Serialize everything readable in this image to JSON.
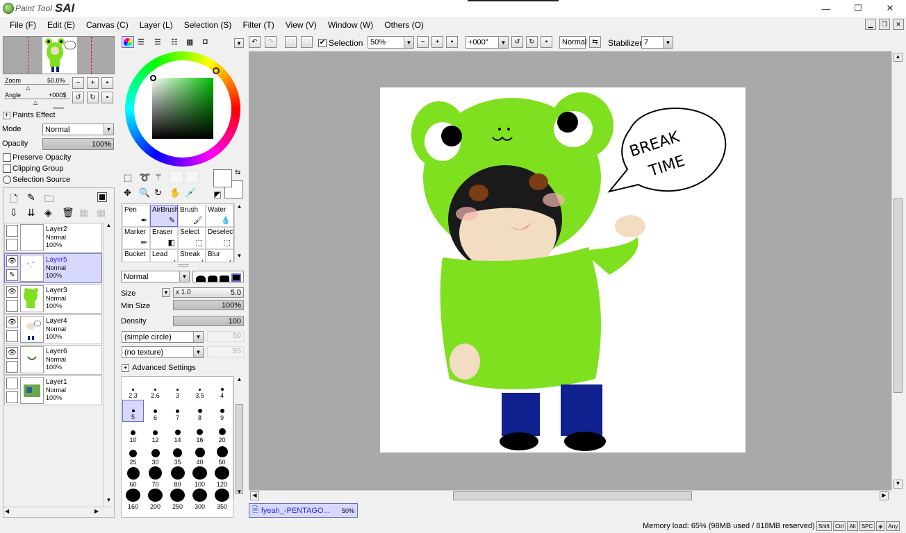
{
  "app": {
    "logo_text": "Paint Tool",
    "logo_sai": "SAI"
  },
  "window_buttons": {
    "minimize": "—",
    "maximize": "☐",
    "close": "✕"
  },
  "menu": [
    "File (F)",
    "Edit (E)",
    "Canvas (C)",
    "Layer (L)",
    "Selection (S)",
    "Filter (T)",
    "View (V)",
    "Window (W)",
    "Others (O)"
  ],
  "navigator": {
    "zoom_label": "Zoom",
    "zoom_value": "50.0%",
    "angle_label": "Angle",
    "angle_value": "+000$"
  },
  "paints_effect": {
    "header": "Paints Effect",
    "mode_label": "Mode",
    "mode_value": "Normal",
    "opacity_label": "Opacity",
    "opacity_value": "100%",
    "opacity_fraction": 1.0
  },
  "options": {
    "preserve_opacity": "Preserve Opacity",
    "clipping_group": "Clipping Group",
    "selection_source": "Selection Source"
  },
  "layers": [
    {
      "name": "Layer2",
      "mode": "Normal",
      "opacity": "100%",
      "visible": false,
      "selected": false
    },
    {
      "name": "Layer5",
      "mode": "Normal",
      "opacity": "100%",
      "visible": true,
      "selected": true
    },
    {
      "name": "Layer3",
      "mode": "Normal",
      "opacity": "100%",
      "visible": true,
      "selected": false
    },
    {
      "name": "Layer4",
      "mode": "Normal",
      "opacity": "100%",
      "visible": true,
      "selected": false
    },
    {
      "name": "Layer6",
      "mode": "Normal",
      "opacity": "100%",
      "visible": true,
      "selected": false
    },
    {
      "name": "Layer1",
      "mode": "Normal",
      "opacity": "100%",
      "visible": false,
      "selected": false
    }
  ],
  "tools": [
    {
      "label": "Pen",
      "icon": "✒",
      "selected": false
    },
    {
      "label": "AirBrush",
      "icon": "✎",
      "selected": true
    },
    {
      "label": "Brush",
      "icon": "🖌",
      "selected": false
    },
    {
      "label": "Water",
      "icon": "💧",
      "selected": false
    },
    {
      "label": "Marker",
      "icon": "✏",
      "selected": false
    },
    {
      "label": "Eraser",
      "icon": "◧",
      "selected": false
    },
    {
      "label": "Select",
      "icon": "⬚",
      "selected": false
    },
    {
      "label": "Deselect",
      "icon": "⬚",
      "selected": false
    },
    {
      "label": "Bucket",
      "icon": "▨",
      "selected": false
    },
    {
      "label": "Lead",
      "icon": "╱",
      "selected": false
    },
    {
      "label": "Streak",
      "icon": "╱",
      "selected": false
    },
    {
      "label": "Blur",
      "icon": "╱",
      "selected": false
    }
  ],
  "brush": {
    "blend_mode": "Normal",
    "size_label": "Size",
    "size_mult": "x 1.0",
    "size_value": "5.0",
    "min_size_label": "Min Size",
    "min_size_value": "100%",
    "density_label": "Density",
    "density_value": "100",
    "shape": "(simple circle)",
    "shape_value": "50",
    "texture": "(no texture)",
    "texture_value": "95",
    "advanced": "Advanced Settings"
  },
  "brush_sizes": [
    "2.3",
    "2.6",
    "3",
    "3.5",
    "4",
    "5",
    "6",
    "7",
    "8",
    "9",
    "10",
    "12",
    "14",
    "16",
    "20",
    "25",
    "30",
    "35",
    "40",
    "50",
    "60",
    "70",
    "80",
    "100",
    "120",
    "160",
    "200",
    "250",
    "300",
    "350"
  ],
  "selected_brush_size": "5",
  "toolbar": {
    "selection_label": "Selection",
    "selection_checked": true,
    "zoom": "50%",
    "angle": "+000°",
    "blend": "Normal",
    "stabilizer_label": "Stabilizer",
    "stabilizer_value": "7"
  },
  "canvas_tab": {
    "name": "fyeah_-PENTAGO...",
    "zoom": "50%"
  },
  "artwork": {
    "speech_line1": "BREAK",
    "speech_line2": "TIME"
  },
  "status": {
    "memory": "Memory load: 65% (98MB used / 818MB reserved)",
    "keys": [
      "Shift",
      "Ctrl",
      "Alt",
      "SPC",
      "◈",
      "Any"
    ]
  },
  "colors": {
    "accent": "#d8d8ff",
    "frog_green": "#7ee01e",
    "pants": "#10208f",
    "workspace": "#a9a9a9"
  }
}
